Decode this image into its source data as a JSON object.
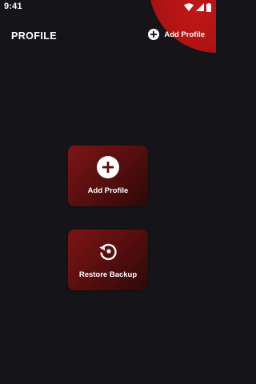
{
  "status_bar": {
    "time": "9:41",
    "icons": [
      "wifi-icon",
      "signal-icon",
      "battery-icon"
    ]
  },
  "header": {
    "title": "PROFILE",
    "add_button_label": "Add Profile",
    "add_button_icon": "plus-circle-icon"
  },
  "actions": {
    "add_profile": {
      "label": "Add Profile",
      "icon": "plus-circle-icon"
    },
    "restore_backup": {
      "label": "Restore Backup",
      "icon": "restore-icon"
    }
  },
  "colors": {
    "background": "#151519",
    "accent": "#b51515",
    "card_gradient_start": "#7d1515",
    "card_gradient_end": "#2e0808",
    "text": "#ffffff"
  }
}
